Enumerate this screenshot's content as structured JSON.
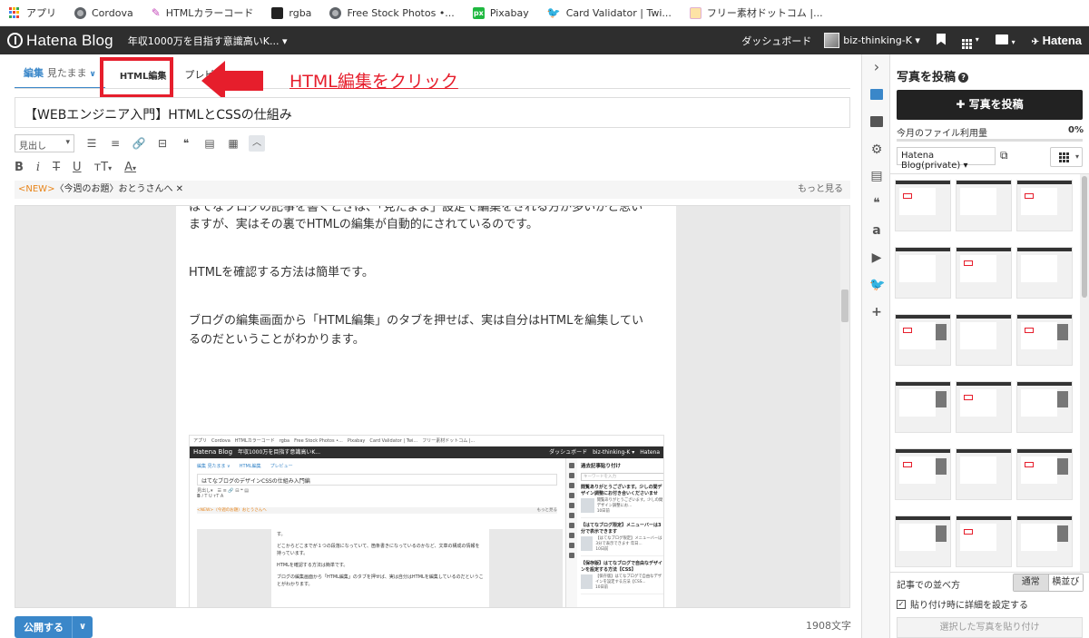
{
  "bookmarks": {
    "items": [
      {
        "label": "アプリ",
        "icon": "apps-icon"
      },
      {
        "label": "Cordova",
        "icon": "globe-icon"
      },
      {
        "label": "HTMLカラーコード",
        "icon": "htmlcc-icon"
      },
      {
        "label": "rgba",
        "icon": "rgba-icon"
      },
      {
        "label": "Free Stock Photos •...",
        "icon": "globe-icon"
      },
      {
        "label": "Pixabay",
        "icon": "pixabay-icon"
      },
      {
        "label": "Card Validator | Twi...",
        "icon": "twitter-icon"
      },
      {
        "label": "フリー素材ドットコム |...",
        "icon": "furi-icon"
      }
    ]
  },
  "header": {
    "logo": "Hatena Blog",
    "blog_select": "年収1000万を目指す意識高いK... ▾",
    "dashboard": "ダッシュボード",
    "user": "biz-thinking-K ▾",
    "brand": "Hatena",
    "colors": {
      "bar": "#2e2e2e"
    }
  },
  "editor": {
    "tabs": [
      {
        "label": "編集",
        "sub": "見たまま"
      },
      {
        "label": "HTML編集"
      },
      {
        "label": "プレビ"
      }
    ],
    "annotation": "HTML編集をクリック",
    "title": "【WEBエンジニア入門】HTMLとCSSの仕組み",
    "heading_select": "見出し",
    "topic_new": "<NEW>",
    "topic_text": "〈今週のお題〉おとうさんへ ✕",
    "topic_more": "もっと見る",
    "body": [
      "はてなブログの記事を書くときは、「見たまま」設定で編集をされる方が多いかと思い",
      "ますが、実はその裏でHTMLの編集が自動的にされているのです。",
      "HTMLを確認する方法は簡単です。",
      "ブログの編集画面から「HTML編集」のタブを押せば、実は自分はHTMLを編集してい",
      "るのだということがわかります。"
    ],
    "publish": "公開する",
    "char_count": "1908文字",
    "accent": "#3a87c9",
    "annotation_color": "#e61e2c"
  },
  "embed": {
    "bookmarks": "アプリ　Cordova　HTMLカラーコード　rgba　Free Stock Photos •...　Pixabay　Card Validator | Twi...　フリー素材ドットコム |...",
    "logo": "Hatena Blog",
    "blog": "年収1000万を目指す意識高いK...",
    "right": "ダッシュボード　biz-thinking-K ▾　Hatena",
    "tabs": "編集 見たまま ∨　　HTML編集　　プレビュー",
    "title": "はてなブログのデザインCSSの仕組み入門編",
    "heading": "見出し",
    "topic": "<NEW>〈今週のお題〉おとうさんへ",
    "topic_more": "もっと見る",
    "p1": "す。",
    "p2": "どこからどこまでが１つの段落になっていて、箇条書きになっているのかなど、文章の構成の情報を持っています。",
    "p3": "HTMLを確認する方法は簡単です。",
    "p4": "ブログの編集画面から「HTML編集」のタブを押せば、実は自分はHTMLを編集しているのだということがわかります。",
    "side_title": "過去記事貼り付け",
    "side_search": "キーワードを入力",
    "cards": [
      {
        "title": "閲覧ありがとうございます。少しの間デザイン調整にお付き合いくださいませ",
        "snippet": "閲覧ありがとうございます。少しの間デザイン調整にお...",
        "date": "10日前"
      },
      {
        "title": "【はてなブログ限定】メニューバーは3分で表示できます",
        "snippet": "【はてなブログ限定】メニューバーは3分で表示できます 年日...",
        "date": "10日前"
      },
      {
        "title": "【保存版】はてなブログで自由なデザインを設定する方法【CSS】",
        "snippet": "【保存版】はてなブログで自由なデザインを設定する方法【CSS...",
        "date": "10日前"
      }
    ]
  },
  "sidebar": {
    "icons": [
      "chevron-right-icon",
      "photo-icon",
      "folder-icon",
      "gear-icon",
      "document-icon",
      "quote-icon",
      "amazon-icon",
      "youtube-icon",
      "twitter-icon",
      "plus-icon"
    ]
  },
  "photo_panel": {
    "title": "写真を投稿",
    "upload": "✚ 写真を投稿",
    "usage_label": "今月のファイル利用量",
    "usage_value": "0%",
    "album": "Hatena Blog(private) ▾",
    "sort_label": "記事での並べ方",
    "sort_options": [
      "通常",
      "横並び"
    ],
    "detail_label": "貼り付け時に詳細を設定する",
    "paste_button": "選択した写真を貼り付け"
  }
}
